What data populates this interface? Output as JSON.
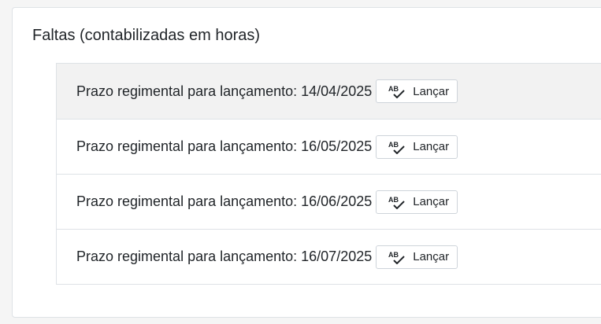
{
  "card": {
    "title": "Faltas (contabilizadas em horas)"
  },
  "rows": [
    {
      "text": "Prazo regimental para lançamento: 14/04/2025",
      "button_label": "Lançar",
      "icon": "spellcheck-icon"
    },
    {
      "text": "Prazo regimental para lançamento: 16/05/2025",
      "button_label": "Lançar",
      "icon": "spellcheck-icon"
    },
    {
      "text": "Prazo regimental para lançamento: 16/06/2025",
      "button_label": "Lançar",
      "icon": "spellcheck-icon"
    },
    {
      "text": "Prazo regimental para lançamento: 16/07/2025",
      "button_label": "Lançar",
      "icon": "spellcheck-icon"
    }
  ]
}
